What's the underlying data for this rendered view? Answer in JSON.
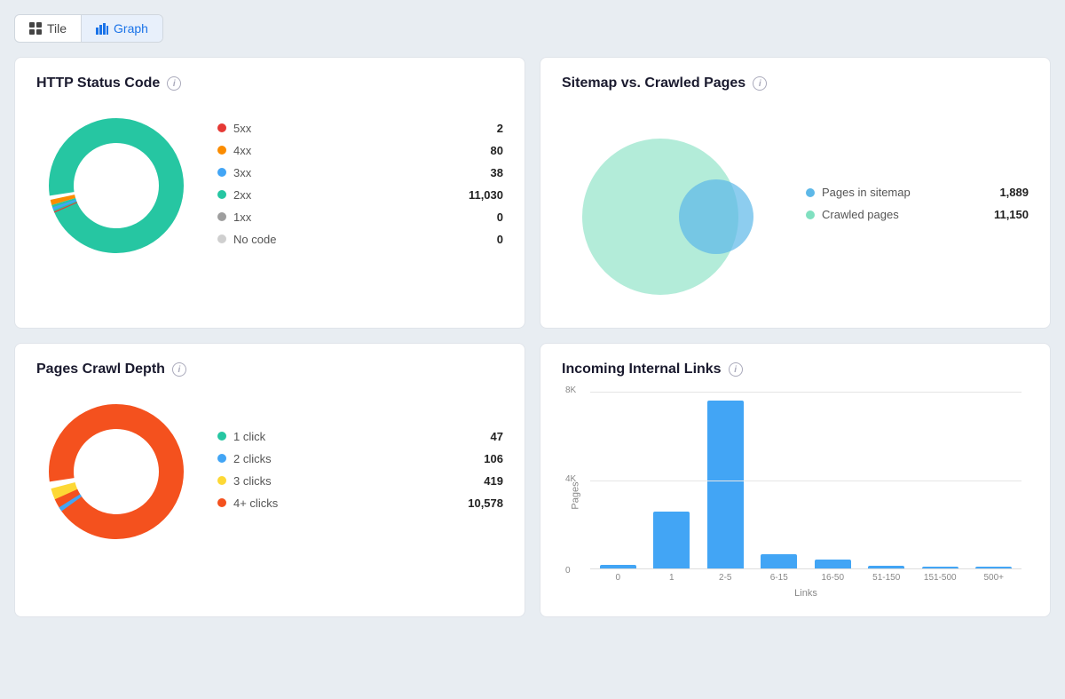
{
  "toolbar": {
    "tile_label": "Tile",
    "graph_label": "Graph"
  },
  "http_status": {
    "title": "HTTP Status Code",
    "legend": [
      {
        "label": "5xx",
        "value": "2",
        "color": "#e53935"
      },
      {
        "label": "4xx",
        "value": "80",
        "color": "#fb8c00"
      },
      {
        "label": "3xx",
        "value": "38",
        "color": "#42a5f5"
      },
      {
        "label": "2xx",
        "value": "11,030",
        "color": "#26c6a2"
      },
      {
        "label": "1xx",
        "value": "0",
        "color": "#9e9e9e"
      },
      {
        "label": "No code",
        "value": "0",
        "color": "#cfcfcf"
      }
    ],
    "donut": {
      "segments": [
        {
          "pct": 97.7,
          "color": "#26c6a2"
        },
        {
          "pct": 0.7,
          "color": "#42a5f5"
        },
        {
          "pct": 0.3,
          "color": "#e53935"
        },
        {
          "pct": 1.3,
          "color": "#fb8c00"
        }
      ]
    }
  },
  "sitemap": {
    "title": "Sitemap vs. Crawled Pages",
    "legend": [
      {
        "label": "Pages in sitemap",
        "value": "1,889",
        "color": "#5db8e8"
      },
      {
        "label": "Crawled pages",
        "value": "11,150",
        "color": "#80e0c0"
      }
    ]
  },
  "crawl_depth": {
    "title": "Pages Crawl Depth",
    "legend": [
      {
        "label": "1 click",
        "value": "47",
        "color": "#26c6a2"
      },
      {
        "label": "2 clicks",
        "value": "106",
        "color": "#42a5f5"
      },
      {
        "label": "3 clicks",
        "value": "419",
        "color": "#fdd835"
      },
      {
        "label": "4+ clicks",
        "value": "10,578",
        "color": "#f4511e"
      }
    ],
    "donut": {
      "segments": [
        {
          "pct": 95.6,
          "color": "#f4511e"
        },
        {
          "pct": 2.8,
          "color": "#fdd835"
        },
        {
          "pct": 0.5,
          "color": "#26c6a2"
        },
        {
          "pct": 1.1,
          "color": "#42a5f5"
        }
      ]
    }
  },
  "internal_links": {
    "title": "Incoming Internal Links",
    "y_label": "Pages",
    "x_label": "Links",
    "y_ticks": [
      "0",
      "4K",
      "8K"
    ],
    "x_ticks": [
      "0",
      "1",
      "2-5",
      "6-15",
      "16-50",
      "51-150",
      "151-500",
      "500+"
    ],
    "bars": [
      {
        "label": "0",
        "height_pct": 2
      },
      {
        "label": "1",
        "height_pct": 32
      },
      {
        "label": "2-5",
        "height_pct": 95
      },
      {
        "label": "6-15",
        "height_pct": 8
      },
      {
        "label": "16-50",
        "height_pct": 5
      },
      {
        "label": "51-150",
        "height_pct": 1.5
      },
      {
        "label": "151-500",
        "height_pct": 1
      },
      {
        "label": "500+",
        "height_pct": 0.8
      }
    ]
  }
}
